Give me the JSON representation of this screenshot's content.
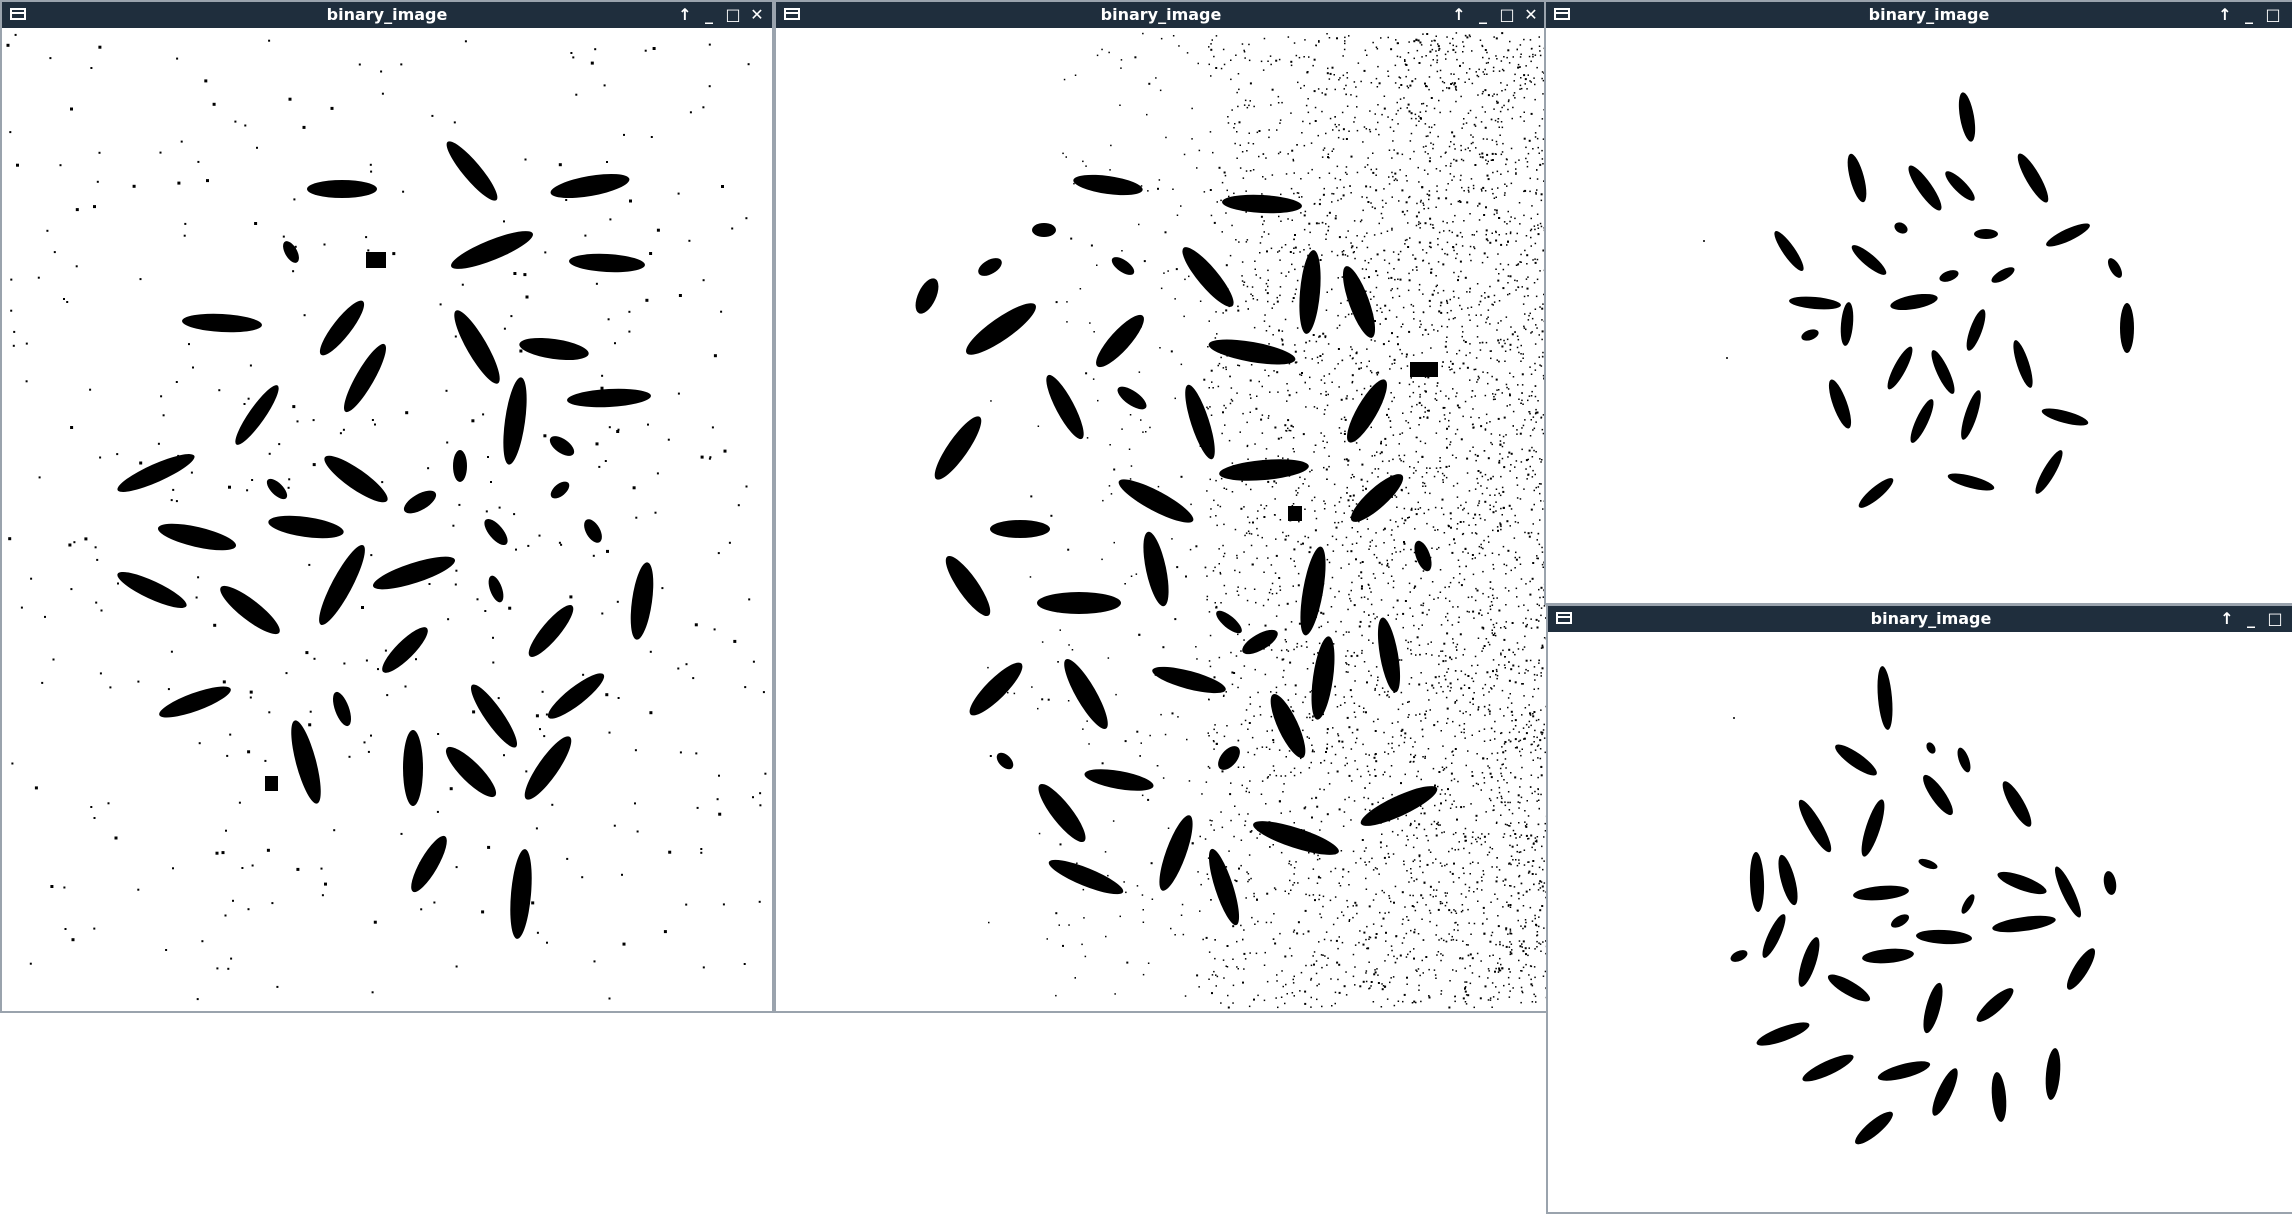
{
  "colors": {
    "titlebar": "#1f2e3d",
    "title_text": "#ffffff",
    "image_bg": "#ffffff",
    "grain": "#000000",
    "frame": "#9aa3ad"
  },
  "icons": {
    "window": "window-menu-icon",
    "above": "arrow-up-icon",
    "minimize": "minimize-icon",
    "maximize": "maximize-icon",
    "close": "close-icon"
  },
  "controls": {
    "above": "↑",
    "minimize": "_",
    "maximize": "□",
    "close": "✕"
  },
  "windows": [
    {
      "title": "binary_image"
    },
    {
      "title": "binary_image"
    },
    {
      "title": "binary_image"
    },
    {
      "title": "binary_image"
    }
  ]
}
